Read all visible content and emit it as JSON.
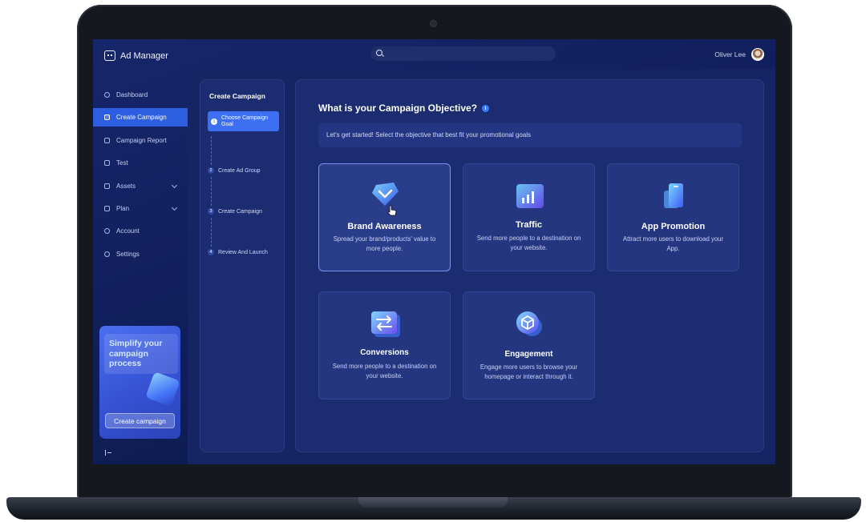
{
  "app": {
    "title": "Ad Manager"
  },
  "search": {
    "placeholder": ""
  },
  "user": {
    "name": "Oliver Lee"
  },
  "sidebar": {
    "items": [
      {
        "label": "Dashboard",
        "active": false
      },
      {
        "label": "Create Campaign",
        "active": true
      },
      {
        "label": "Campaign Report",
        "active": false
      },
      {
        "label": "Test",
        "active": false
      },
      {
        "label": "Assets",
        "active": false,
        "expandable": true
      },
      {
        "label": "Plan",
        "active": false,
        "expandable": true
      },
      {
        "label": "Account",
        "active": false
      },
      {
        "label": "Settings",
        "active": false
      }
    ],
    "promo": {
      "text": "Simplify your campaign process",
      "button": "Create campaign"
    }
  },
  "steps": {
    "title": "Create Campaign",
    "items": [
      {
        "num": "1",
        "label": "Choose Campaign Goal",
        "active": true
      },
      {
        "num": "2",
        "label": "Create Ad Group",
        "active": false
      },
      {
        "num": "3",
        "label": "Create Campaign",
        "active": false
      },
      {
        "num": "4",
        "label": "Review And Launch",
        "active": false
      }
    ]
  },
  "main": {
    "heading": "What is your Campaign Objective?",
    "info": "i",
    "subtitle": "Let's get started! Select the objective that best fit your promotional goals",
    "cards": [
      {
        "title": "Brand Awareness",
        "desc": "Spread your brand/products' value to more people.",
        "icon": "shield-check-icon",
        "selected": true
      },
      {
        "title": "Traffic",
        "desc": "Send more people to a destination on your website.",
        "icon": "bar-chart-icon",
        "selected": false
      },
      {
        "title": "App Promotion",
        "desc": "Attract more users to download your App.",
        "icon": "phone-icon",
        "selected": false
      },
      {
        "title": "Conversions",
        "desc": "Send more people to a destination on your website.",
        "icon": "swap-arrows-icon",
        "selected": false
      },
      {
        "title": "Engagement",
        "desc": "Engage more users to browse your homepage or interact through it.",
        "icon": "cube-icon",
        "selected": false
      }
    ]
  },
  "colors": {
    "accent": "#3c6ff2",
    "background": "#13235f",
    "card": "#24367f"
  }
}
